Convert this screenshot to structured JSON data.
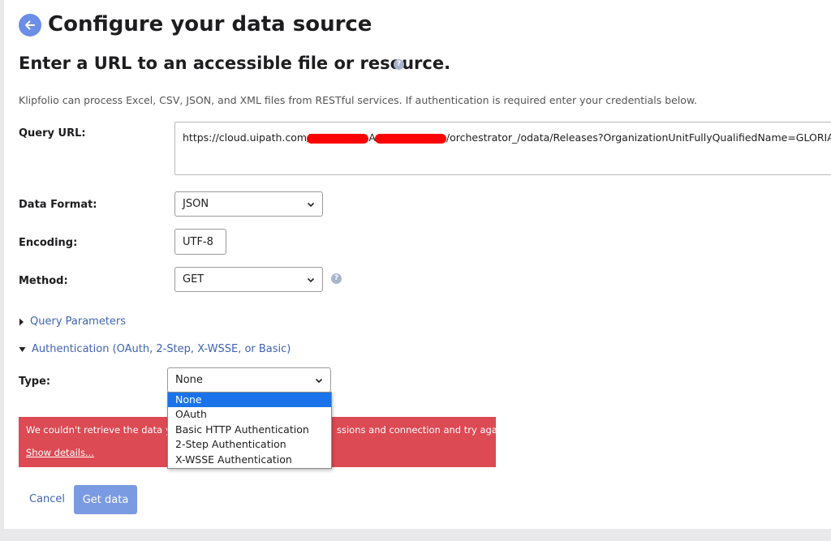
{
  "header": {
    "title": "Configure your data source",
    "subtitle": "Enter a URL to an accessible file or resource.",
    "description": "Klipfolio can process Excel, CSV, JSON, and XML files from RESTful services. If authentication is required enter your credentials below."
  },
  "form": {
    "query_url": {
      "label": "Query URL:",
      "value_start": "https://cloud.uipath.com/",
      "value_middle": "A",
      "value_end": "/orchestrator_/odata/Releases?OrganizationUnitFullyQualifiedName=GLORIA"
    },
    "data_format": {
      "label": "Data Format:",
      "value": "JSON"
    },
    "encoding": {
      "label": "Encoding:",
      "value": "UTF-8"
    },
    "method": {
      "label": "Method:",
      "value": "GET"
    },
    "query_parameters": {
      "label": "Query Parameters"
    },
    "authentication": {
      "label": "Authentication (OAuth, 2-Step, X-WSSE, or Basic)",
      "type_label": "Type:",
      "type_value": "None",
      "options": [
        "None",
        "OAuth",
        "Basic HTTP Authentication",
        "2-Step Authentication",
        "X-WSSE Authentication"
      ]
    }
  },
  "error": {
    "message_start": "We couldn't retrieve the data you",
    "message_end": "ssions and connection and try again.",
    "details_link": "Show details..."
  },
  "actions": {
    "cancel_label": "Cancel",
    "get_data_label": "Get data"
  },
  "colors": {
    "accent": "#6b8fe6",
    "link": "#3f63b3",
    "error": "#dc4a54",
    "selected_option": "#1a73e8"
  }
}
